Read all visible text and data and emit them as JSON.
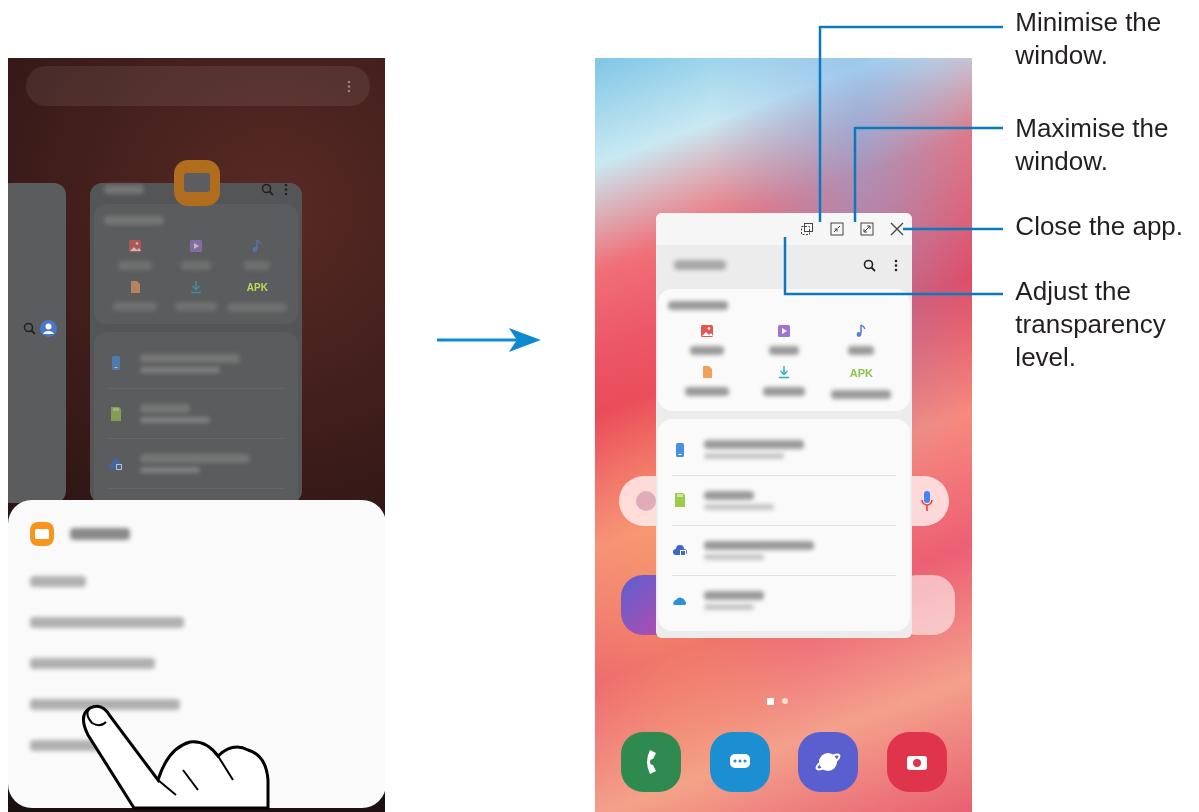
{
  "left_phone": {
    "app_card": {
      "apk_label": "APK"
    }
  },
  "right_phone": {
    "popup_window": {
      "apk_label": "APK"
    }
  },
  "callouts": [
    {
      "kind": "minimise",
      "text": "Minimise the window."
    },
    {
      "kind": "maximise",
      "text": "Maximise the window."
    },
    {
      "kind": "close",
      "text": "Close the app."
    },
    {
      "kind": "transparency",
      "text": "Adjust the transparency level."
    }
  ]
}
